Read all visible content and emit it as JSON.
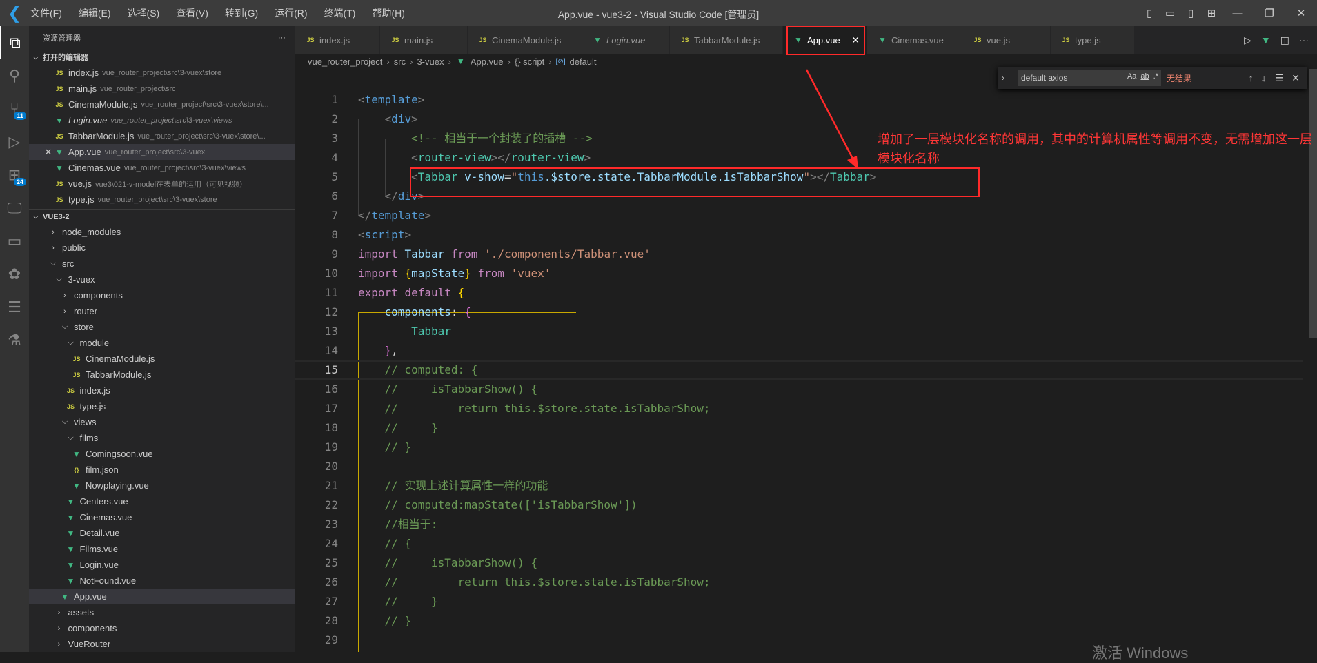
{
  "titlebar": {
    "title": "App.vue - vue3-2 - Visual Studio Code [管理员]",
    "menu": [
      "文件(F)",
      "编辑(E)",
      "选择(S)",
      "查看(V)",
      "转到(G)",
      "运行(R)",
      "终端(T)",
      "帮助(H)"
    ]
  },
  "activity": [
    {
      "icon": "files-icon",
      "active": true
    },
    {
      "icon": "search-icon"
    },
    {
      "icon": "source-control-icon",
      "badge": "11"
    },
    {
      "icon": "run-debug-icon"
    },
    {
      "icon": "extensions-icon",
      "badge": "24"
    },
    {
      "icon": "remote-explorer-icon"
    },
    {
      "icon": "folder-icon"
    },
    {
      "icon": "openai-icon"
    },
    {
      "icon": "list-icon"
    },
    {
      "icon": "testing-icon"
    }
  ],
  "sidebar": {
    "title": "资源管理器",
    "more": "···",
    "open_editors_title": "打开的编辑器",
    "open_editors": [
      {
        "name": "index.js",
        "path": "vue_router_project\\src\\3-vuex\\store",
        "type": "js"
      },
      {
        "name": "main.js",
        "path": "vue_router_project\\src",
        "type": "js"
      },
      {
        "name": "CinemaModule.js",
        "path": "vue_router_project\\src\\3-vuex\\store\\...",
        "type": "js"
      },
      {
        "name": "Login.vue",
        "path": "vue_router_project\\src\\3-vuex\\views",
        "type": "vue",
        "italic": true
      },
      {
        "name": "TabbarModule.js",
        "path": "vue_router_project\\src\\3-vuex\\store\\...",
        "type": "js"
      },
      {
        "name": "App.vue",
        "path": "vue_router_project\\src\\3-vuex",
        "type": "vue",
        "active": true
      },
      {
        "name": "Cinemas.vue",
        "path": "vue_router_project\\src\\3-vuex\\views",
        "type": "vue"
      },
      {
        "name": "vue.js",
        "path": "vue3\\021-v-model在表单的运用（可见视频）",
        "type": "js"
      },
      {
        "name": "type.js",
        "path": "vue_router_project\\src\\3-vuex\\store",
        "type": "js"
      }
    ],
    "workspace_title": "VUE3-2",
    "tree": [
      {
        "label": "node_modules",
        "depth": 0,
        "type": "closed"
      },
      {
        "label": "public",
        "depth": 0,
        "type": "closed"
      },
      {
        "label": "src",
        "depth": 0,
        "type": "open"
      },
      {
        "label": "3-vuex",
        "depth": 1,
        "type": "open"
      },
      {
        "label": "components",
        "depth": 2,
        "type": "closed"
      },
      {
        "label": "router",
        "depth": 2,
        "type": "closed"
      },
      {
        "label": "store",
        "depth": 2,
        "type": "open"
      },
      {
        "label": "module",
        "depth": 3,
        "type": "open"
      },
      {
        "label": "CinemaModule.js",
        "depth": 4,
        "type": "js"
      },
      {
        "label": "TabbarModule.js",
        "depth": 4,
        "type": "js"
      },
      {
        "label": "index.js",
        "depth": 3,
        "type": "js"
      },
      {
        "label": "type.js",
        "depth": 3,
        "type": "js"
      },
      {
        "label": "views",
        "depth": 2,
        "type": "open"
      },
      {
        "label": "films",
        "depth": 3,
        "type": "open"
      },
      {
        "label": "Comingsoon.vue",
        "depth": 4,
        "type": "vue"
      },
      {
        "label": "film.json",
        "depth": 4,
        "type": "json"
      },
      {
        "label": "Nowplaying.vue",
        "depth": 4,
        "type": "vue"
      },
      {
        "label": "Centers.vue",
        "depth": 3,
        "type": "vue"
      },
      {
        "label": "Cinemas.vue",
        "depth": 3,
        "type": "vue"
      },
      {
        "label": "Detail.vue",
        "depth": 3,
        "type": "vue"
      },
      {
        "label": "Films.vue",
        "depth": 3,
        "type": "vue"
      },
      {
        "label": "Login.vue",
        "depth": 3,
        "type": "vue"
      },
      {
        "label": "NotFound.vue",
        "depth": 3,
        "type": "vue"
      },
      {
        "label": "App.vue",
        "depth": 2,
        "type": "vue",
        "active": true
      },
      {
        "label": "assets",
        "depth": 1,
        "type": "closed"
      },
      {
        "label": "components",
        "depth": 1,
        "type": "closed"
      },
      {
        "label": "VueRouter",
        "depth": 1,
        "type": "closed"
      }
    ]
  },
  "tabs": [
    {
      "label": "index.js",
      "type": "js",
      "w": 123
    },
    {
      "label": "main.js",
      "type": "js",
      "w": 127
    },
    {
      "label": "CinemaModule.js",
      "type": "js",
      "w": 166
    },
    {
      "label": "Login.vue",
      "type": "vue",
      "italic": true,
      "w": 127
    },
    {
      "label": "TabbarModule.js",
      "type": "js",
      "w": 164
    },
    {
      "label": "App.vue",
      "type": "vue",
      "active": true,
      "w": 122
    },
    {
      "label": "Cinemas.vue",
      "type": "vue",
      "w": 138
    },
    {
      "label": "vue.js",
      "type": "js",
      "w": 128
    },
    {
      "label": "type.js",
      "type": "js",
      "w": 122
    }
  ],
  "breadcrumb": [
    "vue_router_project",
    "src",
    "3-vuex",
    "App.vue",
    "{} script",
    "default"
  ],
  "find": {
    "value": "default axios",
    "match_case": "Aa",
    "whole_word": "ab",
    "regex": ".*",
    "result": "无结果"
  },
  "annotation": "增加了一层模块化名称的调用，其中的计算机属性等调用不变，无需增加这一层模块化名称",
  "current_line": 15,
  "code": [
    [
      [
        "<",
        "br"
      ],
      [
        "template",
        "tag"
      ],
      [
        ">",
        "br"
      ]
    ],
    [
      [
        "    ",
        "p"
      ],
      [
        "<",
        "br"
      ],
      [
        "div",
        "tag"
      ],
      [
        ">",
        "br"
      ]
    ],
    [
      [
        "        ",
        "p"
      ],
      [
        "<!-- 相当于一个封装了的插槽 -->",
        "com"
      ]
    ],
    [
      [
        "        ",
        "p"
      ],
      [
        "<",
        "br"
      ],
      [
        "router-view",
        "comp"
      ],
      [
        "></",
        "br"
      ],
      [
        "router-view",
        "comp"
      ],
      [
        ">",
        "br"
      ]
    ],
    [
      [
        "        ",
        "p"
      ],
      [
        "<",
        "br"
      ],
      [
        "Tabbar",
        "comp"
      ],
      [
        " ",
        "p"
      ],
      [
        "v-show",
        "attr"
      ],
      [
        "=",
        "p"
      ],
      [
        "\"",
        "str"
      ],
      [
        "this",
        "this"
      ],
      [
        ".$store.state.TabbarModule.isTabbarShow",
        "var"
      ],
      [
        "\"",
        "str"
      ],
      [
        "></",
        "br"
      ],
      [
        "Tabbar",
        "comp"
      ],
      [
        ">",
        "br"
      ]
    ],
    [
      [
        "    ",
        "p"
      ],
      [
        "</",
        "br"
      ],
      [
        "div",
        "tag"
      ],
      [
        ">",
        "br"
      ]
    ],
    [
      [
        "</",
        "br"
      ],
      [
        "template",
        "tag"
      ],
      [
        ">",
        "br"
      ]
    ],
    [
      [
        "<",
        "br"
      ],
      [
        "script",
        "tag"
      ],
      [
        ">",
        "br"
      ]
    ],
    [
      [
        "import",
        "kw"
      ],
      [
        " ",
        "p"
      ],
      [
        "Tabbar",
        "var"
      ],
      [
        " ",
        "p"
      ],
      [
        "from",
        "kw"
      ],
      [
        " ",
        "p"
      ],
      [
        "'./components/Tabbar.vue'",
        "str"
      ]
    ],
    [
      [
        "import",
        "kw"
      ],
      [
        " ",
        "p"
      ],
      [
        "{",
        "b1"
      ],
      [
        "mapState",
        "var"
      ],
      [
        "}",
        "b1"
      ],
      [
        " ",
        "p"
      ],
      [
        "from",
        "kw"
      ],
      [
        " ",
        "p"
      ],
      [
        "'vuex'",
        "str"
      ]
    ],
    [
      [
        "export",
        "kw"
      ],
      [
        " ",
        "p"
      ],
      [
        "default",
        "kw"
      ],
      [
        " ",
        "p"
      ],
      [
        "{",
        "b1"
      ]
    ],
    [
      [
        "    ",
        "p"
      ],
      [
        "components",
        "var"
      ],
      [
        ": ",
        "p"
      ],
      [
        "{",
        "b2"
      ]
    ],
    [
      [
        "        ",
        "p"
      ],
      [
        "Tabbar",
        "comp"
      ]
    ],
    [
      [
        "    ",
        "p"
      ],
      [
        "}",
        "b2"
      ],
      [
        ",",
        "p"
      ]
    ],
    [
      [
        "    ",
        "p"
      ],
      [
        "// computed: {",
        "com"
      ]
    ],
    [
      [
        "    ",
        "p"
      ],
      [
        "//     isTabbarShow() {",
        "com"
      ]
    ],
    [
      [
        "    ",
        "p"
      ],
      [
        "//         return this.$store.state.isTabbarShow;",
        "com"
      ]
    ],
    [
      [
        "    ",
        "p"
      ],
      [
        "//     }",
        "com"
      ]
    ],
    [
      [
        "    ",
        "p"
      ],
      [
        "// }",
        "com"
      ]
    ],
    [],
    [
      [
        "    ",
        "p"
      ],
      [
        "// 实现上述计算属性一样的功能",
        "com"
      ]
    ],
    [
      [
        "    ",
        "p"
      ],
      [
        "// computed:mapState(['isTabbarShow'])",
        "com"
      ]
    ],
    [
      [
        "    ",
        "p"
      ],
      [
        "//相当于:",
        "com"
      ]
    ],
    [
      [
        "    ",
        "p"
      ],
      [
        "// {",
        "com"
      ]
    ],
    [
      [
        "    ",
        "p"
      ],
      [
        "//     isTabbarShow() {",
        "com"
      ]
    ],
    [
      [
        "    ",
        "p"
      ],
      [
        "//         return this.$store.state.isTabbarShow;",
        "com"
      ]
    ],
    [
      [
        "    ",
        "p"
      ],
      [
        "//     }",
        "com"
      ]
    ],
    [
      [
        "    ",
        "p"
      ],
      [
        "// }",
        "com"
      ]
    ],
    []
  ],
  "watermark": "激活 Windows"
}
